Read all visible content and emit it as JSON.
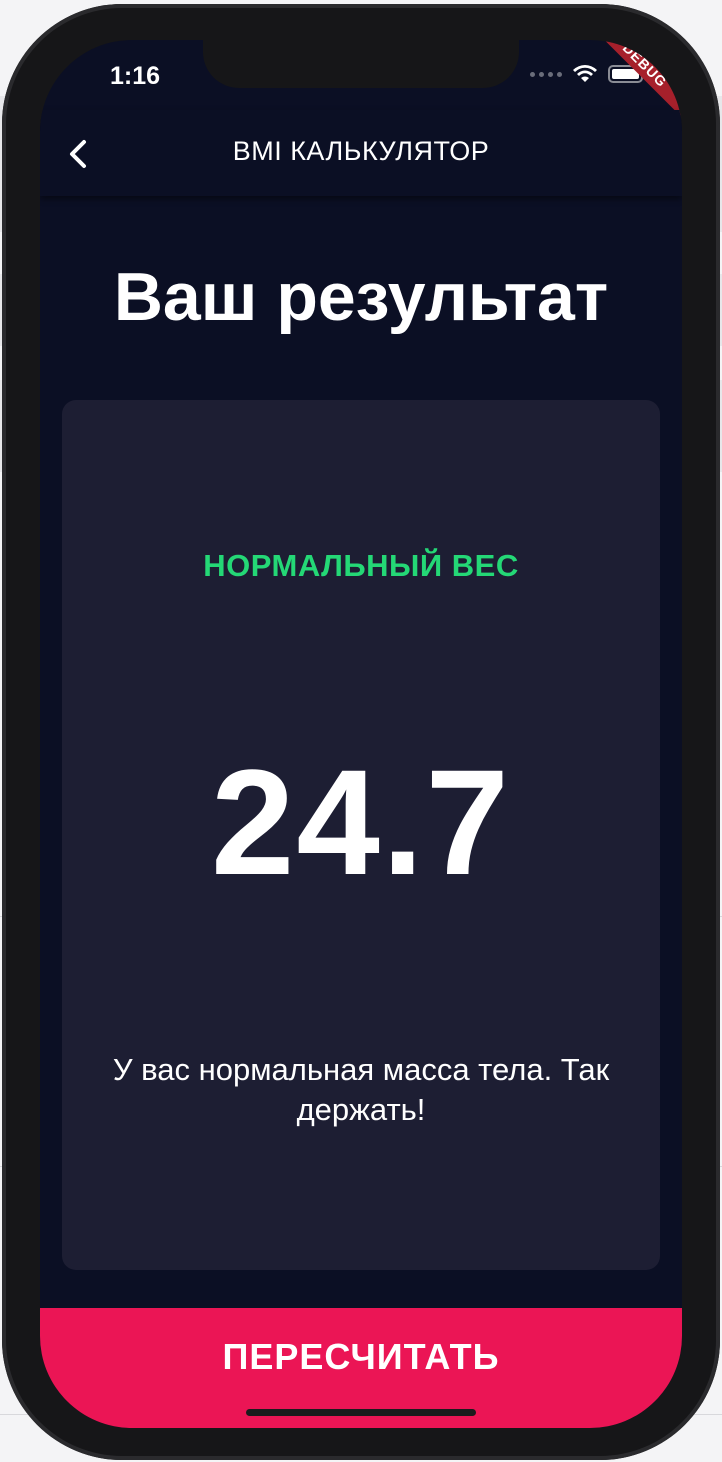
{
  "status_bar": {
    "time": "1:16"
  },
  "debug_banner": {
    "label": "DEBUG",
    "color": "#a6202b"
  },
  "app_bar": {
    "title": "BMI КАЛЬКУЛЯТОР",
    "back_icon": "chevron-left-icon"
  },
  "page": {
    "title": "Ваш результат"
  },
  "result": {
    "status": "НОРМАЛЬНЫЙ ВЕС",
    "status_color": "#24d876",
    "bmi_value": "24.7",
    "message": "У вас нормальная масса тела. Так держать!"
  },
  "action_button": {
    "label": "ПЕРЕСЧИТАТЬ",
    "color": "#eb1555"
  },
  "theme": {
    "background": "#0b0f24",
    "card": "#1d1e33"
  }
}
